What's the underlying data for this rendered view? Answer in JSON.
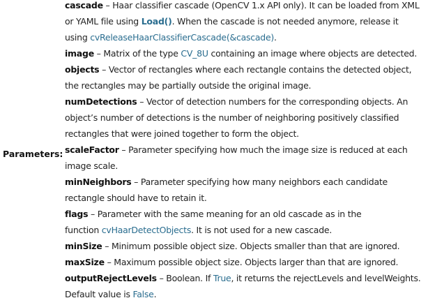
{
  "label": "Parameters:",
  "params": [
    {
      "name": "cascade",
      "lines": [
        [
          {
            "t": "– Haar classifier cascade (OpenCV 1.x API only). It can be loaded from XML"
          }
        ],
        [
          {
            "t": "or YAML file using "
          },
          {
            "t": "Load()",
            "c": "fn"
          },
          {
            "t": ". When the cascade is not needed anymore, release it"
          }
        ],
        [
          {
            "t": "using "
          },
          {
            "t": "cvReleaseHaarClassifierCascade(&cascade)",
            "c": "ref"
          },
          {
            "t": "."
          }
        ]
      ]
    },
    {
      "name": "image",
      "lines": [
        [
          {
            "t": "– Matrix of the type "
          },
          {
            "t": "CV_8U",
            "c": "ref"
          },
          {
            "t": " containing an image where objects are detected."
          }
        ]
      ]
    },
    {
      "name": "objects",
      "lines": [
        [
          {
            "t": "– Vector of rectangles where each rectangle contains the detected object,"
          }
        ],
        [
          {
            "t": "the rectangles may be partially outside the original image."
          }
        ]
      ]
    },
    {
      "name": "numDetections",
      "lines": [
        [
          {
            "t": "– Vector of detection numbers for the corresponding objects. An"
          }
        ],
        [
          {
            "t": "object’s number of detections is the number of neighboring positively classified"
          }
        ],
        [
          {
            "t": "rectangles that were joined together to form the object."
          }
        ]
      ]
    },
    {
      "name": "scaleFactor",
      "lines": [
        [
          {
            "t": "– Parameter specifying how much the image size is reduced at each"
          }
        ],
        [
          {
            "t": "image scale."
          }
        ]
      ]
    },
    {
      "name": "minNeighbors",
      "lines": [
        [
          {
            "t": "– Parameter specifying how many neighbors each candidate"
          }
        ],
        [
          {
            "t": "rectangle should have to retain it."
          }
        ]
      ]
    },
    {
      "name": "flags",
      "lines": [
        [
          {
            "t": "– Parameter with the same meaning for an old cascade as in the"
          }
        ],
        [
          {
            "t": "function "
          },
          {
            "t": "cvHaarDetectObjects",
            "c": "ref"
          },
          {
            "t": ". It is not used for a new cascade."
          }
        ]
      ]
    },
    {
      "name": "minSize",
      "lines": [
        [
          {
            "t": "– Minimum possible object size. Objects smaller than that are ignored."
          }
        ]
      ]
    },
    {
      "name": "maxSize",
      "lines": [
        [
          {
            "t": "– Maximum possible object size. Objects larger than that are ignored."
          }
        ]
      ]
    },
    {
      "name": "outputRejectLevels",
      "lines": [
        [
          {
            "t": "– Boolean. If "
          },
          {
            "t": "True",
            "c": "ref"
          },
          {
            "t": ", it returns the rejectLevels and levelWeights."
          }
        ],
        [
          {
            "t": "Default value is "
          },
          {
            "t": "False",
            "c": "ref"
          },
          {
            "t": "."
          }
        ]
      ]
    }
  ]
}
